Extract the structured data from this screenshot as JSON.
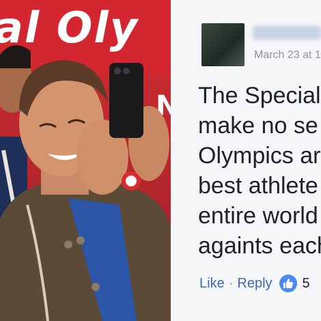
{
  "photo": {
    "banner_text": "al Oly",
    "banner_letter": "N"
  },
  "comment": {
    "date": "March 23 at 1",
    "text": "The Special\nmake no se\nOlympics ar\nbest athlete\nentire world\nagaints each",
    "actions": {
      "like_label": "Like",
      "separator": "·",
      "reply_label": "Reply",
      "reaction_count": "5"
    }
  },
  "colors": {
    "link": "#4267b2",
    "banner_red": "#d32630",
    "reaction_blue": "#4a8af4"
  }
}
